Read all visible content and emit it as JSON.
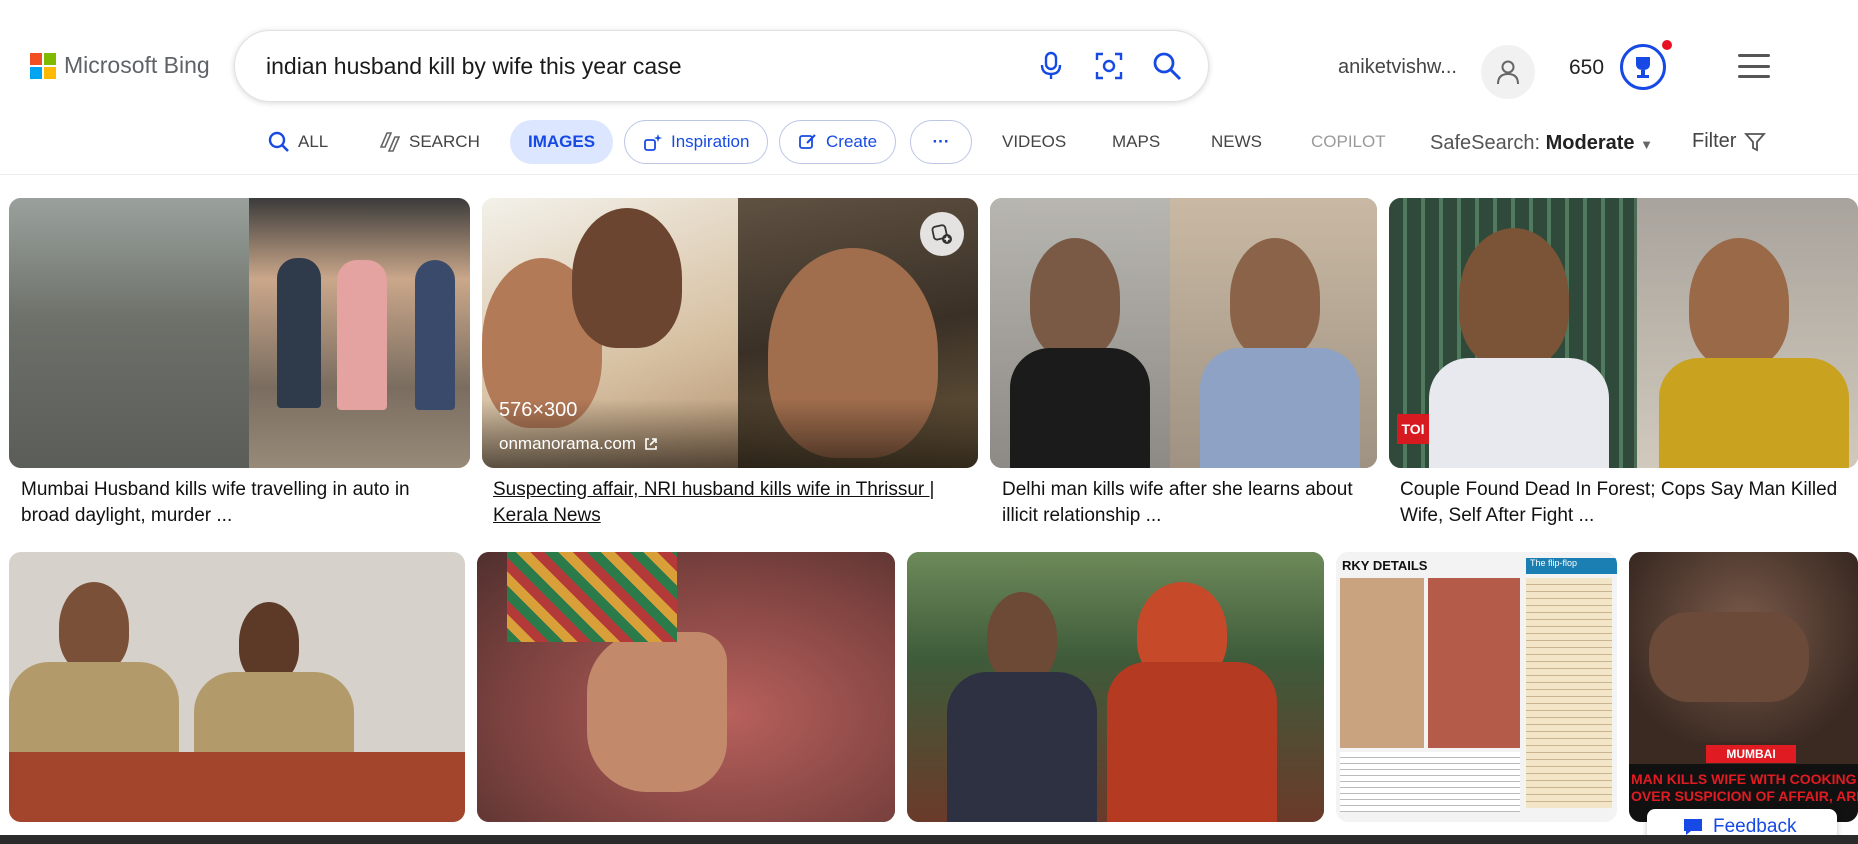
{
  "header": {
    "logo_text": "Microsoft Bing",
    "logo_colors": [
      "#f25022",
      "#7fba00",
      "#00a4ef",
      "#ffb900"
    ],
    "search_query": "indian husband kill by wife this year case",
    "user_name": "aniketvishw...",
    "points": "650",
    "icons": [
      "microphone-icon",
      "visual-search-icon",
      "search-icon",
      "user-icon",
      "rewards-icon",
      "menu-icon"
    ]
  },
  "nav": {
    "all": "ALL",
    "search": "SEARCH",
    "images": "IMAGES",
    "inspiration": "Inspiration",
    "create": "Create",
    "more": "···",
    "videos": "VIDEOS",
    "maps": "MAPS",
    "news": "NEWS",
    "copilot": "COPILOT",
    "safesearch_label": "SafeSearch:",
    "safesearch_value": "Moderate",
    "filter": "Filter"
  },
  "results_row1": [
    {
      "caption": "Mumbai Husband kills wife travelling in auto in broad daylight, murder ..."
    },
    {
      "caption": "Suspecting affair, NRI husband kills wife in Thrissur | Kerala News",
      "size": "576×300",
      "source": "onmanorama.com"
    },
    {
      "caption": "Delhi man kills wife after she learns about illicit relationship ..."
    },
    {
      "caption": "Couple Found Dead In Forest; Cops Say Man Killed Wife, Self After Fight ...",
      "badge": "TOI"
    }
  ],
  "results_row2": [
    {
      "alt": "police press conference"
    },
    {
      "alt": "feet on red floor"
    },
    {
      "alt": "bride and groom"
    },
    {
      "title": "RKY DETAILS",
      "sidebar": "The flip-flop",
      "alt": "newspaper clipping"
    },
    {
      "tag": "MUMBAI",
      "headline_1": "MAN KILLS WIFE WITH COOKING PA",
      "headline_2": "OVER SUSPICION OF AFFAIR, ARREST"
    }
  ],
  "feedback": "Feedback",
  "accent": "#174ae4"
}
